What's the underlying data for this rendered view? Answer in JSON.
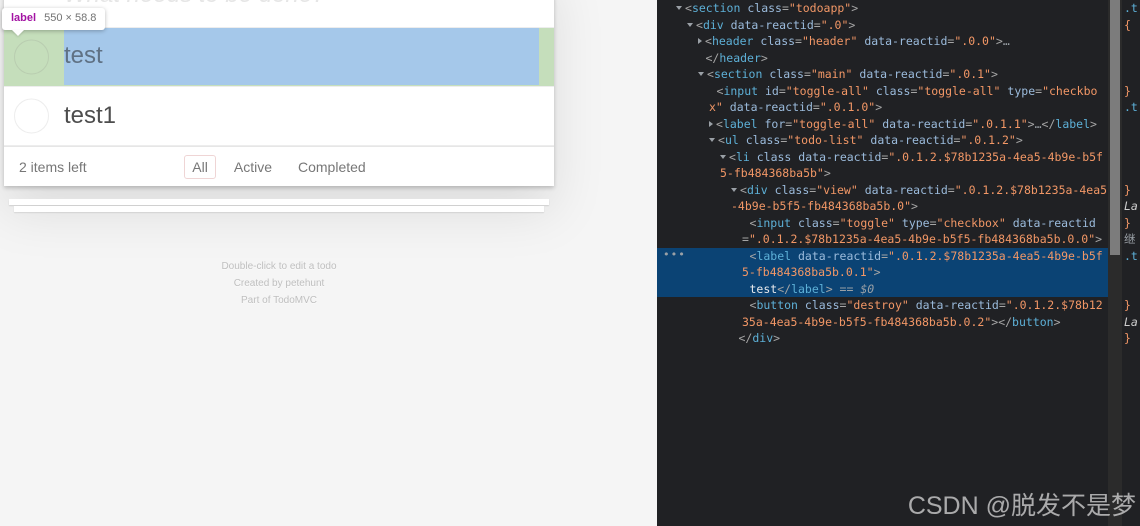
{
  "inspector_badge": {
    "tag": "label",
    "dimensions": "550 × 58.8"
  },
  "page": {
    "new_todo_placeholder": "What needs to be done?",
    "todos": [
      {
        "label": "test",
        "highlighted": true,
        "completed": false
      },
      {
        "label": "test1",
        "highlighted": false,
        "completed": false
      }
    ],
    "footer": {
      "count_text": "2 items left",
      "filters": [
        {
          "label": "All",
          "selected": true
        },
        {
          "label": "Active",
          "selected": false
        },
        {
          "label": "Completed",
          "selected": false
        }
      ]
    },
    "info": [
      "Double-click to edit a todo",
      "Created by petehunt",
      "Part of TodoMVC"
    ]
  },
  "devtools": {
    "accent_selection_color": "#0b4374",
    "annotation_box_color": "#e1272b",
    "dom_lines": [
      {
        "indent": 1,
        "tri": "open",
        "parts": [
          {
            "t": "punct",
            "v": "<"
          },
          {
            "t": "tagname",
            "v": "section"
          },
          {
            "t": "punct",
            "v": " "
          },
          {
            "t": "attrname",
            "v": "class"
          },
          {
            "t": "punct",
            "v": "="
          },
          {
            "t": "attrval",
            "v": "\"todoapp\""
          },
          {
            "t": "punct",
            "v": ">"
          }
        ]
      },
      {
        "indent": 2,
        "tri": "open",
        "parts": [
          {
            "t": "punct",
            "v": "<"
          },
          {
            "t": "tagname",
            "v": "div"
          },
          {
            "t": "punct",
            "v": " "
          },
          {
            "t": "attrname",
            "v": "data-reactid"
          },
          {
            "t": "punct",
            "v": "="
          },
          {
            "t": "attrval",
            "v": "\".0\""
          },
          {
            "t": "punct",
            "v": ">"
          }
        ]
      },
      {
        "indent": 3,
        "tri": "closed",
        "parts": [
          {
            "t": "punct",
            "v": "<"
          },
          {
            "t": "tagname",
            "v": "header"
          },
          {
            "t": "punct",
            "v": " "
          },
          {
            "t": "attrname",
            "v": "class"
          },
          {
            "t": "punct",
            "v": "="
          },
          {
            "t": "attrval",
            "v": "\"header\""
          },
          {
            "t": "punct",
            "v": " "
          },
          {
            "t": "attrname",
            "v": "data-reactid"
          },
          {
            "t": "punct",
            "v": "="
          },
          {
            "t": "attrval",
            "v": "\".0.0\""
          },
          {
            "t": "punct",
            "v": ">"
          },
          {
            "t": "ellipsis",
            "v": "…"
          }
        ]
      },
      {
        "indent": 3,
        "tri": "none",
        "parts": [
          {
            "t": "punct",
            "v": "</"
          },
          {
            "t": "tagname",
            "v": "header"
          },
          {
            "t": "punct",
            "v": ">"
          }
        ]
      },
      {
        "indent": 3,
        "tri": "open",
        "parts": [
          {
            "t": "punct",
            "v": "<"
          },
          {
            "t": "tagname",
            "v": "section"
          },
          {
            "t": "punct",
            "v": " "
          },
          {
            "t": "attrname",
            "v": "class"
          },
          {
            "t": "punct",
            "v": "="
          },
          {
            "t": "attrval",
            "v": "\"main\""
          },
          {
            "t": "punct",
            "v": " "
          },
          {
            "t": "attrname",
            "v": "data-reactid"
          },
          {
            "t": "punct",
            "v": "="
          },
          {
            "t": "attrval",
            "v": "\".0.1\""
          },
          {
            "t": "punct",
            "v": ">"
          }
        ]
      },
      {
        "indent": 4,
        "tri": "none",
        "parts": [
          {
            "t": "punct",
            "v": "<"
          },
          {
            "t": "tagname",
            "v": "input"
          },
          {
            "t": "punct",
            "v": " "
          },
          {
            "t": "attrname",
            "v": "id"
          },
          {
            "t": "punct",
            "v": "="
          },
          {
            "t": "attrval",
            "v": "\"toggle-all\""
          },
          {
            "t": "punct",
            "v": " "
          },
          {
            "t": "attrname",
            "v": "class"
          },
          {
            "t": "punct",
            "v": "="
          },
          {
            "t": "attrval",
            "v": "\"toggle-all\""
          },
          {
            "t": "punct",
            "v": " "
          },
          {
            "t": "attrname",
            "v": "type"
          },
          {
            "t": "punct",
            "v": "="
          },
          {
            "t": "attrval",
            "v": "\"checkbox\""
          },
          {
            "t": "punct",
            "v": " "
          },
          {
            "t": "attrname",
            "v": "data-reactid"
          },
          {
            "t": "punct",
            "v": "="
          },
          {
            "t": "attrval",
            "v": "\".0.1.0\""
          },
          {
            "t": "punct",
            "v": ">"
          }
        ]
      },
      {
        "indent": 4,
        "tri": "closed",
        "parts": [
          {
            "t": "punct",
            "v": "<"
          },
          {
            "t": "tagname",
            "v": "label"
          },
          {
            "t": "punct",
            "v": " "
          },
          {
            "t": "attrname",
            "v": "for"
          },
          {
            "t": "punct",
            "v": "="
          },
          {
            "t": "attrval",
            "v": "\"toggle-all\""
          },
          {
            "t": "punct",
            "v": " "
          },
          {
            "t": "attrname",
            "v": "data-reactid"
          },
          {
            "t": "punct",
            "v": "="
          },
          {
            "t": "attrval",
            "v": "\".0.1.1\""
          },
          {
            "t": "punct",
            "v": ">"
          },
          {
            "t": "ellipsis",
            "v": "…"
          },
          {
            "t": "punct",
            "v": "</"
          },
          {
            "t": "tagname",
            "v": "label"
          },
          {
            "t": "punct",
            "v": ">"
          }
        ]
      },
      {
        "indent": 4,
        "tri": "open",
        "parts": [
          {
            "t": "punct",
            "v": "<"
          },
          {
            "t": "tagname",
            "v": "ul"
          },
          {
            "t": "punct",
            "v": " "
          },
          {
            "t": "attrname",
            "v": "class"
          },
          {
            "t": "punct",
            "v": "="
          },
          {
            "t": "attrval",
            "v": "\"todo-list\""
          },
          {
            "t": "punct",
            "v": " "
          },
          {
            "t": "attrname",
            "v": "data-reactid"
          },
          {
            "t": "punct",
            "v": "="
          },
          {
            "t": "attrval",
            "v": "\".0.1.2\""
          },
          {
            "t": "punct",
            "v": ">"
          }
        ]
      },
      {
        "indent": 5,
        "tri": "open",
        "parts": [
          {
            "t": "punct",
            "v": "<"
          },
          {
            "t": "tagname",
            "v": "li"
          },
          {
            "t": "punct",
            "v": " "
          },
          {
            "t": "attrname",
            "v": "class"
          },
          {
            "t": "punct",
            "v": " "
          },
          {
            "t": "attrname",
            "v": "data-reactid"
          },
          {
            "t": "punct",
            "v": "="
          },
          {
            "t": "attrval",
            "v": "\".0.1.2.$78b1235a-4ea5-4b9e-b5f5-fb484368ba5b\""
          },
          {
            "t": "punct",
            "v": ">"
          }
        ]
      },
      {
        "indent": 6,
        "tri": "open",
        "parts": [
          {
            "t": "punct",
            "v": "<"
          },
          {
            "t": "tagname",
            "v": "div"
          },
          {
            "t": "punct",
            "v": " "
          },
          {
            "t": "attrname",
            "v": "class"
          },
          {
            "t": "punct",
            "v": "="
          },
          {
            "t": "attrval",
            "v": "\"view\""
          },
          {
            "t": "punct",
            "v": " "
          },
          {
            "t": "attrname",
            "v": "data-reactid"
          },
          {
            "t": "punct",
            "v": "="
          },
          {
            "t": "attrval",
            "v": "\".0.1.2.$78b1235a-4ea5-4b9e-b5f5-fb484368ba5b.0\""
          },
          {
            "t": "punct",
            "v": ">"
          }
        ]
      },
      {
        "indent": 7,
        "tri": "none",
        "parts": [
          {
            "t": "punct",
            "v": "<"
          },
          {
            "t": "tagname",
            "v": "input"
          },
          {
            "t": "punct",
            "v": " "
          },
          {
            "t": "attrname",
            "v": "class"
          },
          {
            "t": "punct",
            "v": "="
          },
          {
            "t": "attrval",
            "v": "\"toggle\""
          },
          {
            "t": "punct",
            "v": " "
          },
          {
            "t": "attrname",
            "v": "type"
          },
          {
            "t": "punct",
            "v": "="
          },
          {
            "t": "attrval",
            "v": "\"checkbox\""
          },
          {
            "t": "punct",
            "v": " "
          },
          {
            "t": "attrname",
            "v": "data-reactid"
          },
          {
            "t": "punct",
            "v": "="
          },
          {
            "t": "attrval",
            "v": "\".0.1.2.$78b1235a-4ea5-4b9e-b5f5-fb484368ba5b.0.0\""
          },
          {
            "t": "punct",
            "v": ">"
          }
        ]
      },
      {
        "indent": 7,
        "tri": "none",
        "selected": true,
        "parts": [
          {
            "t": "punct",
            "v": "<"
          },
          {
            "t": "tagname",
            "v": "label"
          },
          {
            "t": "punct",
            "v": " "
          },
          {
            "t": "attrname",
            "v": "data-reactid"
          },
          {
            "t": "punct",
            "v": "="
          },
          {
            "t": "attrval",
            "v": "\".0.1.2.$78b1235a-4ea5-4b9e-b5f5-fb484368ba5b.0.1\""
          },
          {
            "t": "punct",
            "v": ">"
          }
        ]
      },
      {
        "indent": 7,
        "tri": "none",
        "selected": true,
        "parts": [
          {
            "t": "textnode",
            "v": "test"
          },
          {
            "t": "punct",
            "v": "</"
          },
          {
            "t": "tagname",
            "v": "label"
          },
          {
            "t": "punct",
            "v": ">"
          },
          {
            "t": "dollar",
            "v": " == $0"
          }
        ]
      },
      {
        "indent": 7,
        "tri": "none",
        "parts": [
          {
            "t": "punct",
            "v": "<"
          },
          {
            "t": "tagname",
            "v": "button"
          },
          {
            "t": "punct",
            "v": " "
          },
          {
            "t": "attrname",
            "v": "class"
          },
          {
            "t": "punct",
            "v": "="
          },
          {
            "t": "attrval",
            "v": "\"destroy\""
          },
          {
            "t": "punct",
            "v": " "
          },
          {
            "t": "attrname",
            "v": "data-reactid"
          },
          {
            "t": "punct",
            "v": "="
          },
          {
            "t": "attrval",
            "v": "\".0.1.2.$78b1235a-4ea5-4b9e-b5f5-fb484368ba5b.0.2\""
          },
          {
            "t": "punct",
            "v": ">"
          },
          {
            "t": "punct",
            "v": "</"
          },
          {
            "t": "tagname",
            "v": "button"
          },
          {
            "t": "punct",
            "v": ">"
          }
        ]
      },
      {
        "indent": 6,
        "tri": "none",
        "parts": [
          {
            "t": "punct",
            "v": "</"
          },
          {
            "t": "tagname",
            "v": "div"
          },
          {
            "t": "punct",
            "v": ">"
          }
        ]
      }
    ],
    "styles_pane_lines": [
      {
        "kind": "sel",
        "text": ".t"
      },
      {
        "kind": "brace",
        "text": "{"
      },
      {
        "kind": "blank",
        "text": ""
      },
      {
        "kind": "blank",
        "text": ""
      },
      {
        "kind": "blank",
        "text": ""
      },
      {
        "kind": "brace",
        "text": "}"
      },
      {
        "kind": "sel",
        "text": ".t"
      },
      {
        "kind": "blank",
        "text": ""
      },
      {
        "kind": "blank",
        "text": ""
      },
      {
        "kind": "blank",
        "text": ""
      },
      {
        "kind": "blank",
        "text": ""
      },
      {
        "kind": "brace",
        "text": "}"
      },
      {
        "kind": "ital",
        "text": "La"
      },
      {
        "kind": "brace",
        "text": "}"
      },
      {
        "kind": "inh",
        "text": "继"
      },
      {
        "kind": "sel",
        "text": ".t"
      },
      {
        "kind": "blank",
        "text": ""
      },
      {
        "kind": "blank",
        "text": ""
      },
      {
        "kind": "brace",
        "text": "}"
      },
      {
        "kind": "ital",
        "text": "La"
      },
      {
        "kind": "brace",
        "text": "}"
      }
    ]
  },
  "watermark": "CSDN @脱发不是梦"
}
